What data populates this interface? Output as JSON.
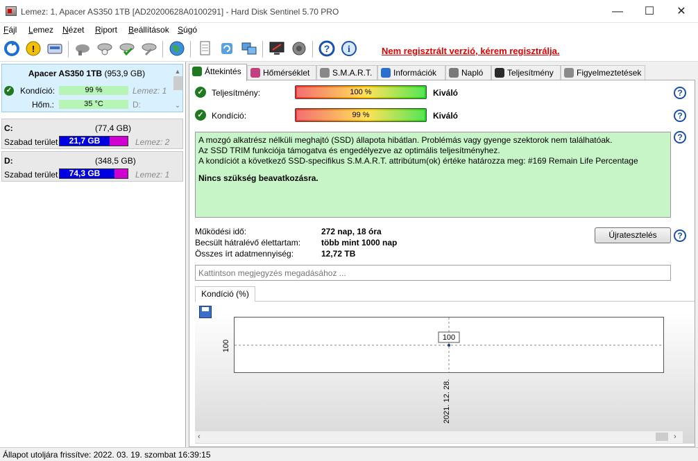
{
  "window": {
    "title": "Lemez: 1, Apacer AS350 1TB [AD20200628A0100291]  -  Hard Disk Sentinel 5.70 PRO",
    "minimize": "—",
    "maximize": "☐",
    "close": "✕"
  },
  "menu": [
    {
      "u": "F",
      "rest": "ájl"
    },
    {
      "u": "L",
      "rest": "emez"
    },
    {
      "u": "N",
      "rest": "ézet"
    },
    {
      "u": "R",
      "rest": "iport"
    },
    {
      "u": "B",
      "rest": "eállítások"
    },
    {
      "u": "S",
      "rest": "úgó"
    }
  ],
  "toolbar": {
    "register_text": "Nem regisztrált verzió, kérem regisztrálja."
  },
  "disk": {
    "name": "Apacer AS350 1TB",
    "size": "(953,9 GB)",
    "condition_label": "Kondíció:",
    "condition_value": "99 %",
    "condition_pct": 99,
    "temp_label": "Hőm.:",
    "temp_value": "35 °C",
    "ghost1": "Lemez: 1",
    "ghost2": "D:"
  },
  "partitions": [
    {
      "letter": "C:",
      "size": "(77,4 GB)",
      "free_label": "Szabad terület",
      "free": "21,7 GB",
      "free_frac": 0.28,
      "ghost": "Lemez: 2"
    },
    {
      "letter": "D:",
      "size": "(348,5 GB)",
      "free_label": "Szabad terület",
      "free": "74,3 GB",
      "free_frac": 0.21,
      "ghost": "Lemez: 1"
    }
  ],
  "tabs": [
    "Áttekintés",
    "Hőmérséklet",
    "S.M.A.R.T.",
    "Információk",
    "Napló",
    "Teljesítmény",
    "Figyelmeztetések"
  ],
  "colors": {
    "tab_icons": [
      "#1f7a1f",
      "#c04080",
      "#888888",
      "#2a6fd0",
      "#7a7a7a",
      "#2a2a2a",
      "#8a8a8a"
    ]
  },
  "overview": {
    "performance_label": "Teljesítmény:",
    "performance_value": "100 %",
    "performance_pct": 100,
    "performance_rating": "Kiváló",
    "health_label": "Kondíció:",
    "health_value": "99 %",
    "health_pct": 99,
    "health_rating": "Kiváló",
    "status_lines": [
      "A mozgó alkatrész nélküli meghajtó (SSD) állapota hibátlan. Problémás vagy gyenge szektorok nem találhatóak.",
      "Az SSD TRIM funkciója támogatva és engedélyezve az optimális teljesítményhez.",
      "A kondíciót a következő SSD-specifikus S.M.A.R.T. attribútum(ok) értéke határozza meg:  #169 Remain Life Percentage"
    ],
    "status_bold": "Nincs szükség beavatkozásra.",
    "uptime_label": "Működési idő:",
    "uptime_value": "272 nap, 18 óra",
    "lifetime_label": "Becsült hátralévő élettartam:",
    "lifetime_value": "több mint 1000 nap",
    "written_label": "Összes írt adatmennyiség:",
    "written_value": "12,72 TB",
    "reset_button": "Újratesztelés",
    "comment_placeholder": "Kattintson megjegyzés megadásához ..."
  },
  "graph_tab": "Kondíció  (%)",
  "chart_data": {
    "type": "line",
    "x": [
      "2021. 12. 28."
    ],
    "series": [
      {
        "values": [
          100
        ]
      }
    ],
    "point_label": "100",
    "y_tick": "100",
    "x_tick": "2021. 12. 28."
  },
  "statusbar": "Állapot utoljára frissítve: 2022. 03. 19. szombat 16:39:15"
}
